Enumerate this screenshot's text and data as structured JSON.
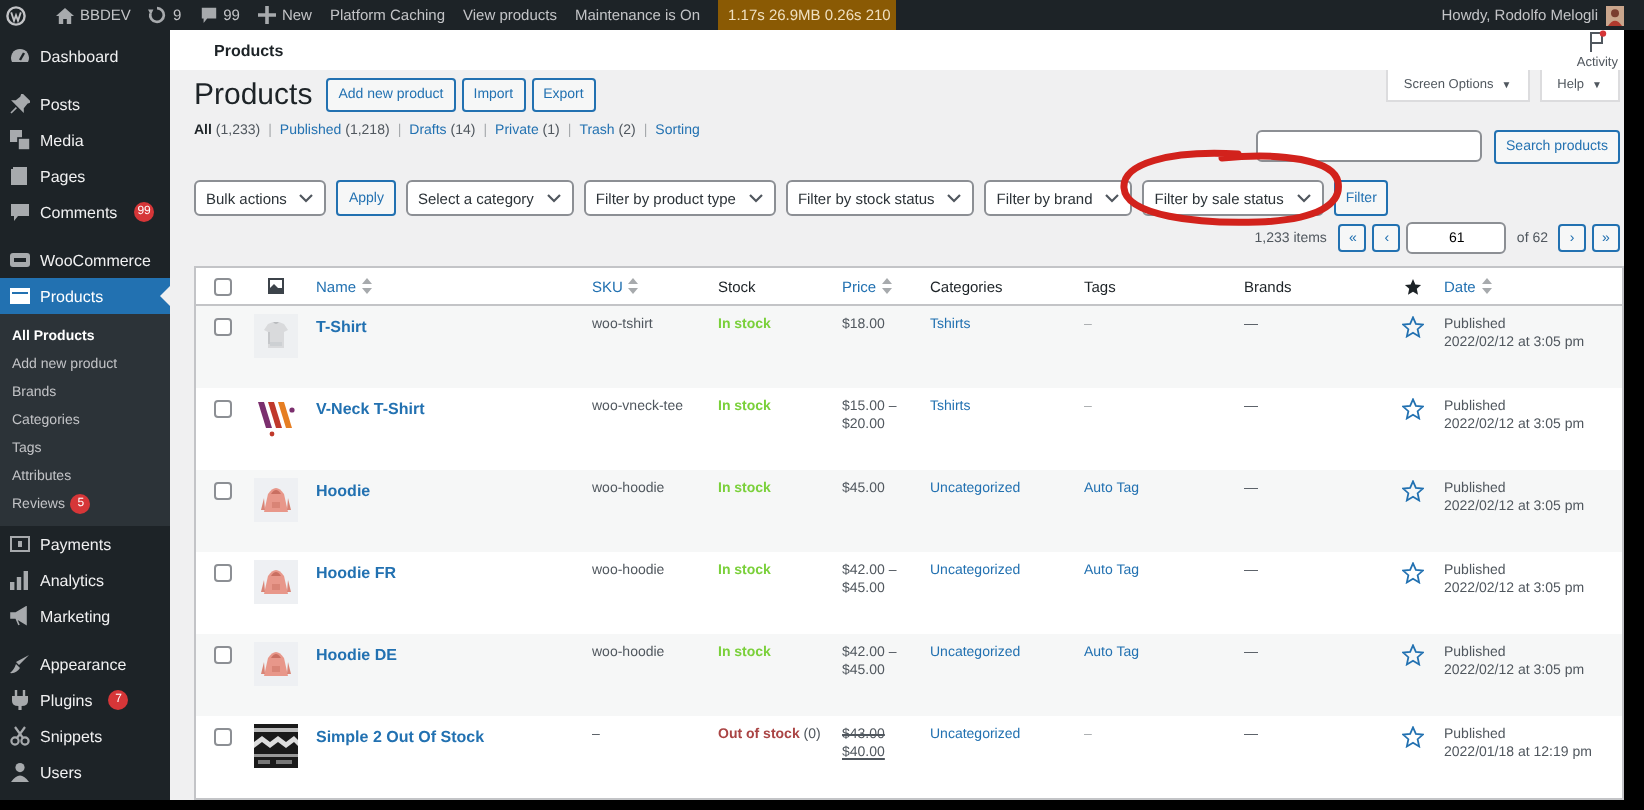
{
  "admin_bar": {
    "site": "BBDEV",
    "updates": "9",
    "comments": "99",
    "new": "New",
    "links": [
      "Platform Caching",
      "View products",
      "Maintenance is On"
    ],
    "performance": "1.17s 26.9MB 0.26s 210",
    "greeting": "Howdy, Rodolfo Melogli"
  },
  "sidebar": {
    "groups": [
      [
        {
          "label": "Dashboard",
          "selected": false
        }
      ],
      [
        {
          "label": "Posts",
          "selected": false
        },
        {
          "label": "Media",
          "selected": false
        },
        {
          "label": "Pages",
          "selected": false
        },
        {
          "label": "Comments",
          "badge": "99",
          "selected": false
        }
      ],
      [
        {
          "label": "WooCommerce",
          "selected": false
        },
        {
          "label": "Products",
          "selected": true,
          "children": [
            {
              "label": "All Products",
              "selected": true
            },
            {
              "label": "Add new product",
              "selected": false
            },
            {
              "label": "Brands",
              "selected": false
            },
            {
              "label": "Categories",
              "selected": false
            },
            {
              "label": "Tags",
              "selected": false
            },
            {
              "label": "Attributes",
              "selected": false
            },
            {
              "label": "Reviews",
              "badge": "5",
              "selected": false
            }
          ]
        },
        {
          "label": "Payments",
          "selected": false
        },
        {
          "label": "Analytics",
          "selected": false
        },
        {
          "label": "Marketing",
          "selected": false
        }
      ],
      [
        {
          "label": "Appearance",
          "selected": false
        },
        {
          "label": "Plugins",
          "badge": "7",
          "selected": false
        },
        {
          "label": "Snippets",
          "selected": false
        },
        {
          "label": "Users",
          "selected": false
        }
      ]
    ]
  },
  "header": {
    "title": "Products",
    "activity": "Activity"
  },
  "page": {
    "title": "Products",
    "actions": [
      "Add new product",
      "Import",
      "Export"
    ],
    "screen_tabs": [
      {
        "label": "Screen Options",
        "arrow": "▼"
      },
      {
        "label": "Help",
        "arrow": "▼"
      }
    ],
    "views": [
      {
        "label": "All",
        "count": "(1,233)",
        "selected": true
      },
      {
        "label": "Published",
        "count": "(1,218)",
        "selected": false
      },
      {
        "label": "Drafts",
        "count": "(14)",
        "selected": false
      },
      {
        "label": "Private",
        "count": "(1)",
        "selected": false
      },
      {
        "label": "Trash",
        "count": "(2)",
        "selected": false
      },
      {
        "label": "Sorting",
        "selected": false
      }
    ],
    "view_separator": "|",
    "search": {
      "button": "Search products"
    },
    "bulk_action": "Bulk actions",
    "apply": "Apply",
    "filters": [
      "Select a category",
      "Filter by product type",
      "Filter by stock status",
      "Filter by brand",
      "Filter by sale status"
    ],
    "filter_button": "Filter",
    "annotation": {
      "kind": "circle"
    },
    "pagination": {
      "count": "1,233 items",
      "first": "«",
      "prev": "‹",
      "page": "61",
      "total": "of 62",
      "next": "›",
      "last": "»"
    }
  },
  "table": {
    "select_all": {
      "checked": false
    },
    "columns": [
      {
        "label": "Name",
        "sortable": true
      },
      {
        "label": "SKU",
        "sortable": true
      },
      {
        "label": "Stock",
        "sortable": false
      },
      {
        "label": "Price",
        "sortable": true
      },
      {
        "label": "Categories",
        "sortable": false
      },
      {
        "label": "Tags",
        "sortable": false
      },
      {
        "label": "Brands",
        "sortable": false
      },
      {
        "kind": "featured"
      },
      {
        "label": "Date",
        "sortable": true
      }
    ],
    "rows": [
      {
        "checked": false,
        "name": "T-Shirt",
        "sku": "woo-tshirt",
        "stock": {
          "text": "In stock",
          "kind": "instock"
        },
        "price": [
          "$18.00"
        ],
        "on_sale": false,
        "category": "Tshirts",
        "tags": {
          "text": "–",
          "link": false
        },
        "brands": "—",
        "featured": false,
        "status": "Published",
        "date": "2022/02/12 at 3:05 pm"
      },
      {
        "checked": false,
        "name": "V-Neck T-Shirt",
        "sku": "woo-vneck-tee",
        "stock": {
          "text": "In stock",
          "kind": "instock"
        },
        "price": [
          "$15.00 –",
          "$20.00"
        ],
        "on_sale": false,
        "category": "Tshirts",
        "tags": {
          "text": "–",
          "link": false
        },
        "brands": "—",
        "featured": false,
        "status": "Published",
        "date": "2022/02/12 at 3:05 pm"
      },
      {
        "checked": false,
        "name": "Hoodie",
        "sku": "woo-hoodie",
        "stock": {
          "text": "In stock",
          "kind": "instock"
        },
        "price": [
          "$45.00"
        ],
        "on_sale": false,
        "category": "Uncategorized",
        "tags": {
          "text": "Auto Tag",
          "link": true
        },
        "brands": "—",
        "featured": false,
        "status": "Published",
        "date": "2022/02/12 at 3:05 pm"
      },
      {
        "checked": false,
        "name": "Hoodie FR",
        "sku": "woo-hoodie",
        "stock": {
          "text": "In stock",
          "kind": "instock"
        },
        "price": [
          "$42.00 –",
          "$45.00"
        ],
        "on_sale": false,
        "category": "Uncategorized",
        "tags": {
          "text": "Auto Tag",
          "link": true
        },
        "brands": "—",
        "featured": false,
        "status": "Published",
        "date": "2022/02/12 at 3:05 pm"
      },
      {
        "checked": false,
        "name": "Hoodie DE",
        "sku": "woo-hoodie",
        "stock": {
          "text": "In stock",
          "kind": "instock"
        },
        "price": [
          "$42.00 –",
          "$45.00"
        ],
        "on_sale": false,
        "category": "Uncategorized",
        "tags": {
          "text": "Auto Tag",
          "link": true
        },
        "brands": "—",
        "featured": false,
        "status": "Published",
        "date": "2022/02/12 at 3:05 pm"
      },
      {
        "checked": false,
        "name": "Simple 2 Out Of Stock",
        "sku": "–",
        "stock": {
          "text": "Out of stock",
          "kind": "outofstock",
          "count": "(0)"
        },
        "price": [
          "$43.00",
          "$40.00"
        ],
        "on_sale": true,
        "category": "Uncategorized",
        "tags": {
          "text": "–",
          "link": false
        },
        "brands": "—",
        "featured": false,
        "status": "Published",
        "date": "2022/01/18 at 12:19 pm"
      }
    ]
  }
}
